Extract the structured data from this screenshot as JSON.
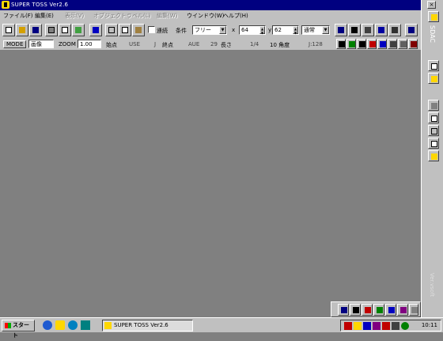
{
  "window": {
    "title": "SUPER TOSS Ver2.6",
    "minimize": "_",
    "maximize": "□",
    "close": "×"
  },
  "menubar": {
    "items": [
      {
        "label": "ファイル(F)",
        "enabled": true
      },
      {
        "label": "編集(E)",
        "enabled": true
      },
      {
        "label": "表示(V)",
        "enabled": false
      },
      {
        "label": "オブジェクト",
        "enabled": false
      },
      {
        "label": "ラベル(L)",
        "enabled": false
      },
      {
        "label": "編集(W)",
        "enabled": false
      },
      {
        "label": "ウインドウ(W)",
        "enabled": true
      },
      {
        "label": "ヘルプ(H)",
        "enabled": true
      }
    ]
  },
  "toolbar": {
    "check_label": "連続",
    "condition_label": "条件",
    "condition_value": "フリー",
    "x_label": "x",
    "x_value": "64",
    "y_label": "y",
    "y_value": "62",
    "mode_value": "通常"
  },
  "toolbar2": {
    "mode_label": "MODE",
    "mode_value": "画像",
    "zoom_label": "ZOOM",
    "zoom_value": "1.00",
    "start_label": "始点",
    "start_value": "USE",
    "start_unit": "J",
    "end_label": "終点",
    "end_value": "AUE",
    "end_unit": "29",
    "length_label": "長さ",
    "length_value": "1/4",
    "angle_label": "10 角度",
    "size_value": "J:128"
  },
  "rightbar": {
    "vertical_text_top": "SDAC",
    "vertical_text_bottom": "Ver.vsoft"
  },
  "taskbar": {
    "start_label": "スタート",
    "task_label": "SUPER TOSS Ver2.6",
    "clock": "10:11"
  }
}
